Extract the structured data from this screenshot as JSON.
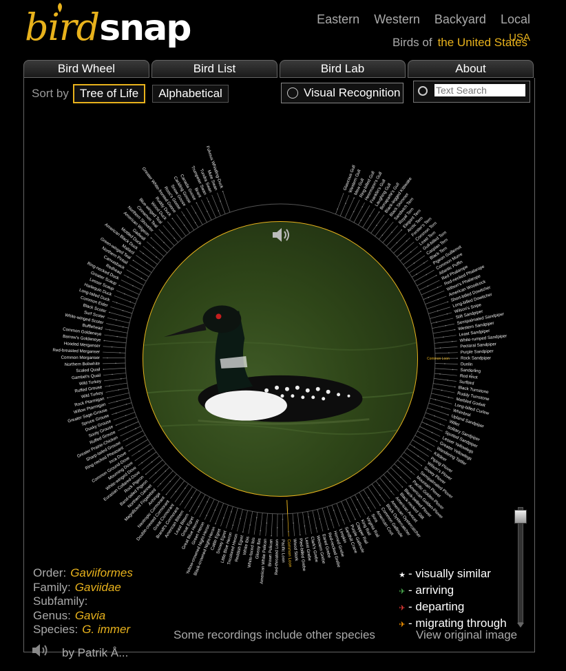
{
  "logo": {
    "bird": "bird",
    "snap": "snap"
  },
  "region_nav": [
    "Eastern",
    "Western",
    "Backyard",
    "Local"
  ],
  "birds_of": {
    "prefix": "Birds of",
    "location": "the United States",
    "usa": "USA"
  },
  "main_tabs": [
    "Bird Wheel",
    "Bird List",
    "Bird Lab",
    "About"
  ],
  "sort": {
    "label": "Sort by",
    "options": [
      "Tree of Life",
      "Alphabetical"
    ],
    "active": "Tree of Life"
  },
  "visual_recognition": "Visual Recognition",
  "search": {
    "placeholder": "Text Search"
  },
  "selected_bird": "Common Loon",
  "taxonomy": {
    "order_label": "Order:",
    "order": "Gaviiformes",
    "family_label": "Family:",
    "family": "Gaviidae",
    "subfamily_label": "Subfamily:",
    "subfamily": "",
    "genus_label": "Genus:",
    "genus": "Gavia",
    "species_label": "Species:",
    "species": "G. immer"
  },
  "legend": [
    {
      "marker": "★",
      "color": "#ffffff",
      "text": "- visually similar"
    },
    {
      "marker": "✈",
      "color": "#4caf50",
      "text": "- arriving"
    },
    {
      "marker": "✈",
      "color": "#e53935",
      "text": "- departing"
    },
    {
      "marker": "✈",
      "color": "#ff9800",
      "text": "- migrating through"
    }
  ],
  "recordings_note": "Some recordings include other species",
  "view_original": "View original image",
  "credit": "by Patrik Å...",
  "colors": {
    "accent": "#e8b21c",
    "background": "#000000",
    "text": "#cccccc"
  },
  "birds": [
    "Glaucous Gull",
    "Western Gull",
    "Mew Gull",
    "Ring-billed Gull",
    "Heermann's Gull",
    "Franklin's Gull",
    "Laughing Gull",
    "Bonaparte's Gull",
    "Black-legged Kittiwake",
    "Black Skimmer",
    "Sandwich Tern",
    "Royal Tern",
    "Elegant Tern",
    "Arctic Tern",
    "Forster's Tern",
    "Common Tern",
    "Least Tern",
    "Gull-billed Tern",
    "Caspian Tern",
    "Black Tern",
    "Pigeon Guillemot",
    "Common Murre",
    "Atlantic Puffin",
    "Red Phalarope",
    "Red-necked Phalarope",
    "Wilson's Phalarope",
    "American Woodcock",
    "Short-billed Dowitcher",
    "Long-billed Dowitcher",
    "Wilson's Snipe",
    "Stilt Sandpiper",
    "Semipalmated Sandpiper",
    "Western Sandpiper",
    "Least Sandpiper",
    "White-rumped Sandpiper",
    "Pectoral Sandpiper",
    "Purple Sandpiper",
    "Rock Sandpiper",
    "Dunlin",
    "Sanderling",
    "Red Knot",
    "Surfbird",
    "Black Turnstone",
    "Ruddy Turnstone",
    "Marbled Godwit",
    "Long-billed Curlew",
    "Whimbrel",
    "Upland Sandpiper",
    "Willet",
    "Solitary Sandpiper",
    "Spotted Sandpiper",
    "Lesser Yellowlegs",
    "Greater Yellowlegs",
    "Wandering Tattler",
    "Killdeer",
    "Piping Plover",
    "Wilson's Plover",
    "Snowy Plover",
    "Semipalmated Plover",
    "Mountain Plover",
    "Pacific Golden-Plover",
    "American Golden-Plover",
    "Black-bellied Plover",
    "Black-necked Stilt",
    "American Avocet",
    "American Oystercatcher",
    "Black Oystercatcher",
    "Common Gallinule",
    "American Coot",
    "Sora",
    "Virginia Rail",
    "King Rail",
    "Clapper Rail",
    "Purple Gallinule",
    "Sandhill Crane",
    "Limpkin",
    "Horned Grebe",
    "Red-necked Grebe",
    "Eared Grebe",
    "Western Grebe",
    "Clark's Grebe",
    "Least Grebe",
    "Pied-billed Grebe",
    "Wood Stork",
    "Common Loon",
    "Pacific Loon",
    "Red-throated Loon",
    "Brown Pelican",
    "American White Pelican",
    "Glossy Ibis",
    "White-faced Ibis",
    "White Ibis",
    "Reddish Egret",
    "Tricolored Heron",
    "Little Blue Heron",
    "Snowy Egret",
    "Cattle Egret",
    "Black-crowned Night-Heron",
    "Yellow-crowned Night-Heron",
    "Green Heron",
    "Great Blue Heron",
    "Great Egret",
    "Least Bittern",
    "American Bittern",
    "Brandt's Cormorant",
    "Great Cormorant",
    "Double-crested Cormorant",
    "Neotropic Cormorant",
    "Anhinga",
    "Magnificent Frigatebird",
    "Northern Gannet",
    "Band-tailed Pigeon",
    "Rock Pigeon",
    "Eurasian Collared-Dove",
    "White-winged Dove",
    "Mourning Dove",
    "Common Ground-Dove",
    "Inca Dove",
    "Ring-necked Pheasant",
    "Sharp-tailed Grouse",
    "Greater Prairie-Chicken",
    "Ruffed Grouse",
    "Sooty Grouse",
    "Dusky Grouse",
    "Spruce Grouse",
    "Greater Sage-Grouse",
    "Willow Ptarmigan",
    "Rock Ptarmigan",
    "Wild Turkey",
    "Ruffed Grouse",
    "Wild Turkey",
    "Gambel's Quail",
    "Scaled Quail",
    "Northern Bobwhite",
    "Common Merganser",
    "Red-breasted Merganser",
    "Hooded Merganser",
    "Barrow's Goldeneye",
    "Common Goldeneye",
    "Bufflehead",
    "White-winged Scoter",
    "Surf Scoter",
    "Black Scoter",
    "Common Eider",
    "Long-tailed Duck",
    "Harlequin Duck",
    "Lesser Scaup",
    "Greater Scaup",
    "Ring-necked Duck",
    "Redhead",
    "Canvasback",
    "Northern Pintail",
    "Green-winged Teal",
    "Mallard",
    "American Black Duck",
    "Mottled Duck",
    "Gadwall",
    "American Wigeon",
    "Northern Shoveler",
    "Cinnamon Teal",
    "Blue-winged Teal",
    "Wood Duck",
    "Ruddy Duck",
    "Greater White-fronted Goose",
    "Ross's Goose",
    "Snow Goose",
    "Cackling Goose",
    "Canada Goose",
    "Brant",
    "Trumpeter Swan",
    "Tundra Swan",
    "Mute Swan",
    "Fulvous Whistling-Duck"
  ]
}
